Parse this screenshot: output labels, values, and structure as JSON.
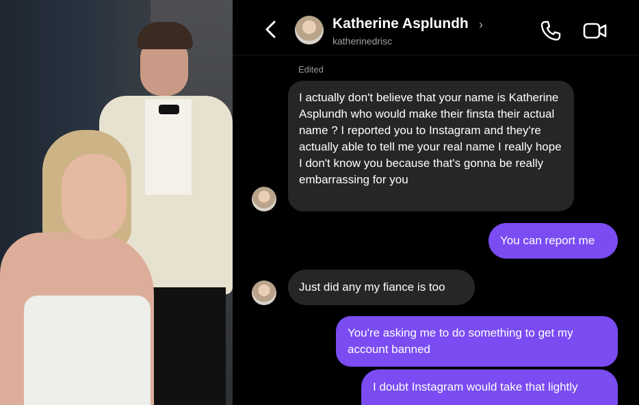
{
  "header": {
    "name": "Katherine Asplundh",
    "chevron": "›",
    "handle": "katherinedrisc"
  },
  "icons": {
    "back": "back-arrow-icon",
    "phone": "phone-icon",
    "video": "video-camera-icon"
  },
  "thread": {
    "edited_label": "Edited",
    "messages": [
      {
        "from": "them",
        "text": "I actually don't believe that your name is Katherine Asplundh who would make their finsta their actual name ? I reported you to Instagram and they're actually able to tell me your real name I really hope I don't know you because that's gonna be really embarrassing for you"
      },
      {
        "from": "me",
        "text": "You can report me"
      },
      {
        "from": "them",
        "text": "Just did any my fiance is too"
      },
      {
        "from": "me",
        "text": "You're asking me to do something to get my account banned"
      },
      {
        "from": "me",
        "text": "I doubt Instagram would take that lightly"
      }
    ]
  },
  "colors": {
    "background": "#000000",
    "incoming_bubble": "#262626",
    "outgoing_bubble": "#7a4cf2",
    "text": "#ffffff",
    "secondary_text": "#a0a0a0"
  }
}
